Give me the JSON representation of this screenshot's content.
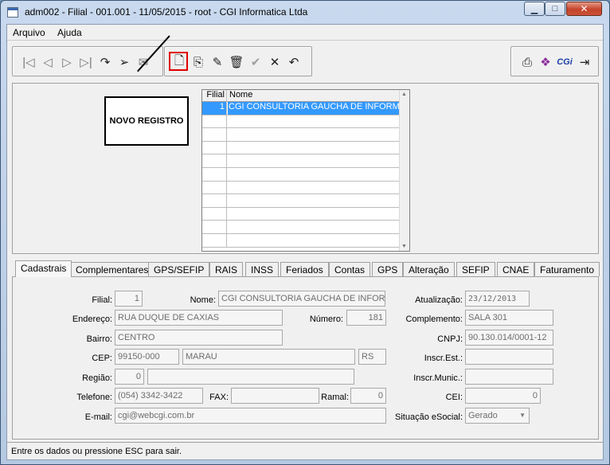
{
  "window": {
    "title": "adm002 - Filial - 001.001 - 11/05/2015 - root - CGI Informatica Ltda",
    "controls": {
      "minimize": "▁",
      "maximize": "□",
      "close": "✕"
    }
  },
  "menu": {
    "items": [
      "Arquivo",
      "Ajuda"
    ]
  },
  "toolbar": {
    "nav_icons": [
      "first-record-icon",
      "previous-record-icon",
      "next-record-icon",
      "last-record-icon",
      "refresh-icon",
      "send-icon",
      "print-preview-icon"
    ],
    "edit_icons": [
      "new-record-icon",
      "copy-record-icon",
      "edit-record-icon",
      "delete-record-icon",
      "confirm-icon",
      "cancel-icon",
      "undo-icon"
    ],
    "right_icons": [
      "printer-icon",
      "book-icon",
      "cgi-logo-icon",
      "exit-icon"
    ],
    "cgi_logo_text": "CGi"
  },
  "annotation": {
    "label": "NOVO REGISTRO"
  },
  "grid": {
    "headers": [
      "Filial",
      "Nome"
    ],
    "rows": [
      {
        "filial": "1",
        "nome": "CGI CONSULTORIA GAUCHA DE INFORMATICA"
      }
    ]
  },
  "tabs": [
    "Cadastrais",
    "Complementares",
    "GPS/SEFIP",
    "RAIS",
    "INSS",
    "Feriados",
    "Contas",
    "GPS",
    "Alteração",
    "SEFIP",
    "CNAE",
    "Faturamento"
  ],
  "form": {
    "filial": {
      "label": "Filial:",
      "value": "1"
    },
    "nome": {
      "label": "Nome:",
      "value": "CGI CONSULTORIA GAUCHA DE INFORMATICA"
    },
    "atualizacao": {
      "label": "Atualização:",
      "value": "23/12/2013"
    },
    "endereco": {
      "label": "Endereço:",
      "value": "RUA DUQUE DE CAXIAS"
    },
    "numero": {
      "label": "Número:",
      "value": "181"
    },
    "complemento": {
      "label": "Complemento:",
      "value": "SALA 301"
    },
    "bairro": {
      "label": "Bairro:",
      "value": "CENTRO"
    },
    "cnpj": {
      "label": "CNPJ:",
      "value": "90.130.014/0001-12"
    },
    "cep": {
      "label": "CEP:",
      "value": "99150-000",
      "cidade": "MARAU",
      "uf": "RS"
    },
    "inscr_est": {
      "label": "Inscr.Est.:",
      "value": ""
    },
    "regiao": {
      "label": "Região:",
      "value": "0",
      "descricao": ""
    },
    "inscr_munic": {
      "label": "Inscr.Munic.:",
      "value": ""
    },
    "telefone": {
      "label": "Telefone:",
      "value": "(054) 3342-3422"
    },
    "fax": {
      "label": "FAX:",
      "value": ""
    },
    "ramal": {
      "label": "Ramal:",
      "value": "0"
    },
    "cei": {
      "label": "CEI:",
      "value": "0"
    },
    "email": {
      "label": "E-mail:",
      "value": "cgi@webcgi.com.br"
    },
    "situacao_esocial": {
      "label": "Situação eSocial:",
      "value": "Gerado"
    }
  },
  "status": {
    "text": "Entre os dados ou pressione ESC para sair."
  }
}
